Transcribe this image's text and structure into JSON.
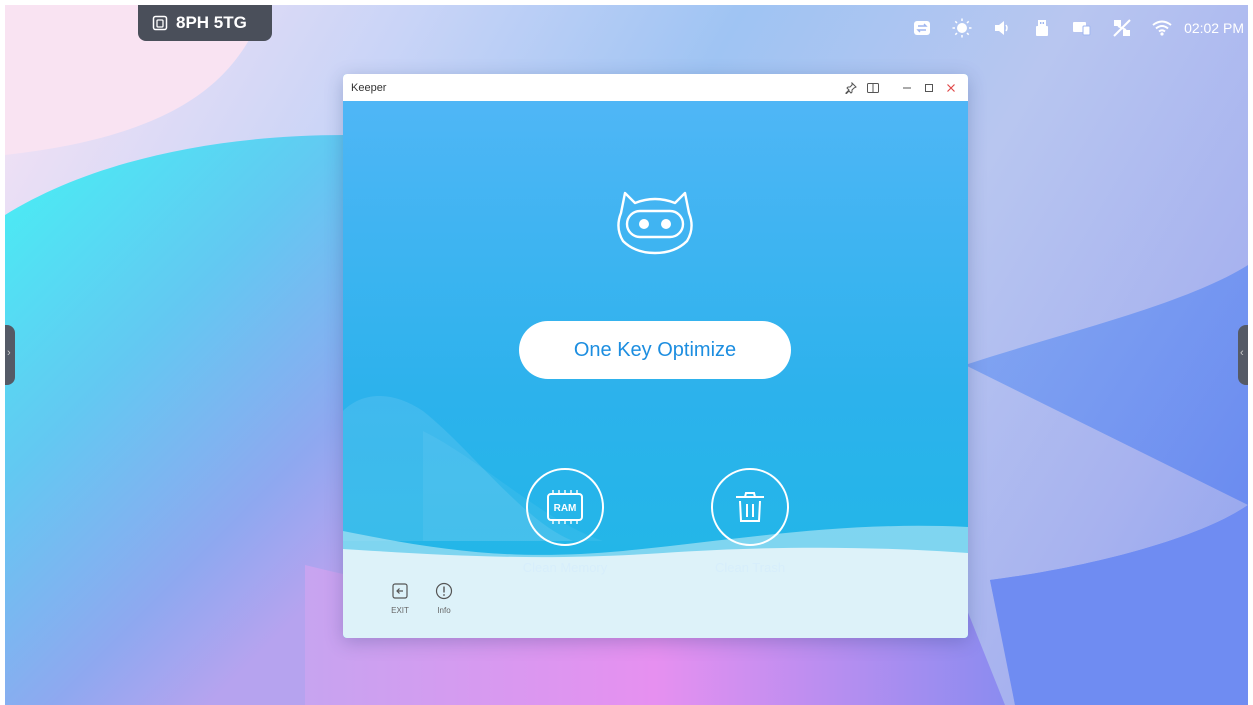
{
  "badge": {
    "code": "8PH 5TG",
    "icon": "cast-screen-icon"
  },
  "status_bar": {
    "icons": [
      "input-source-icon",
      "brightness-icon",
      "volume-icon",
      "usb-icon",
      "screen-share-icon",
      "wired-network-disconnected-icon",
      "wifi-icon"
    ],
    "time": "02:02 PM"
  },
  "window": {
    "title": "Keeper",
    "controls": [
      "pin-icon",
      "split-view-icon",
      "minimize-icon",
      "maximize-icon",
      "close-icon"
    ]
  },
  "app": {
    "optimize_label": "One Key Optimize",
    "ram_chip_text": "RAM",
    "clean_memory_label": "Clean Memory",
    "clean_trash_label": "Clean Trash",
    "exit_label": "EXIT",
    "info_label": "Info"
  },
  "colors": {
    "accent": "#1d8ee0",
    "close": "#e04848",
    "window_blue": "#4ab4f2"
  }
}
